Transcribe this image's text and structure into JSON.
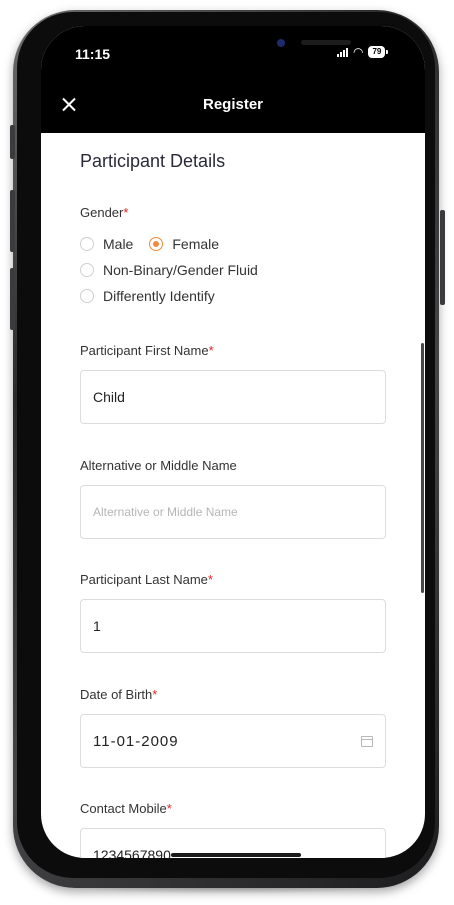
{
  "status_bar": {
    "time": "11:15",
    "battery": "79"
  },
  "nav": {
    "title": "Register",
    "close_icon": "close-icon"
  },
  "form": {
    "section_title": "Participant Details",
    "gender": {
      "label": "Gender",
      "required_mark": "*",
      "options": [
        "Male",
        "Female",
        "Non-Binary/Gender Fluid",
        "Differently Identify"
      ],
      "selected": "Female"
    },
    "first_name": {
      "label": "Participant First Name",
      "required_mark": "*",
      "value": "Child"
    },
    "middle_name": {
      "label": "Alternative or Middle Name",
      "placeholder": "Alternative or Middle Name",
      "value": ""
    },
    "last_name": {
      "label": "Participant Last Name",
      "required_mark": "*",
      "value": "1"
    },
    "dob": {
      "label": "Date of Birth",
      "required_mark": "*",
      "value": "11-01-2009",
      "icon": "calendar-icon"
    },
    "mobile": {
      "label": "Contact Mobile",
      "required_mark": "*",
      "value": "1234567890"
    }
  },
  "colors": {
    "accent": "#f08a3c",
    "required": "#e02424",
    "header_bg": "#000000"
  }
}
